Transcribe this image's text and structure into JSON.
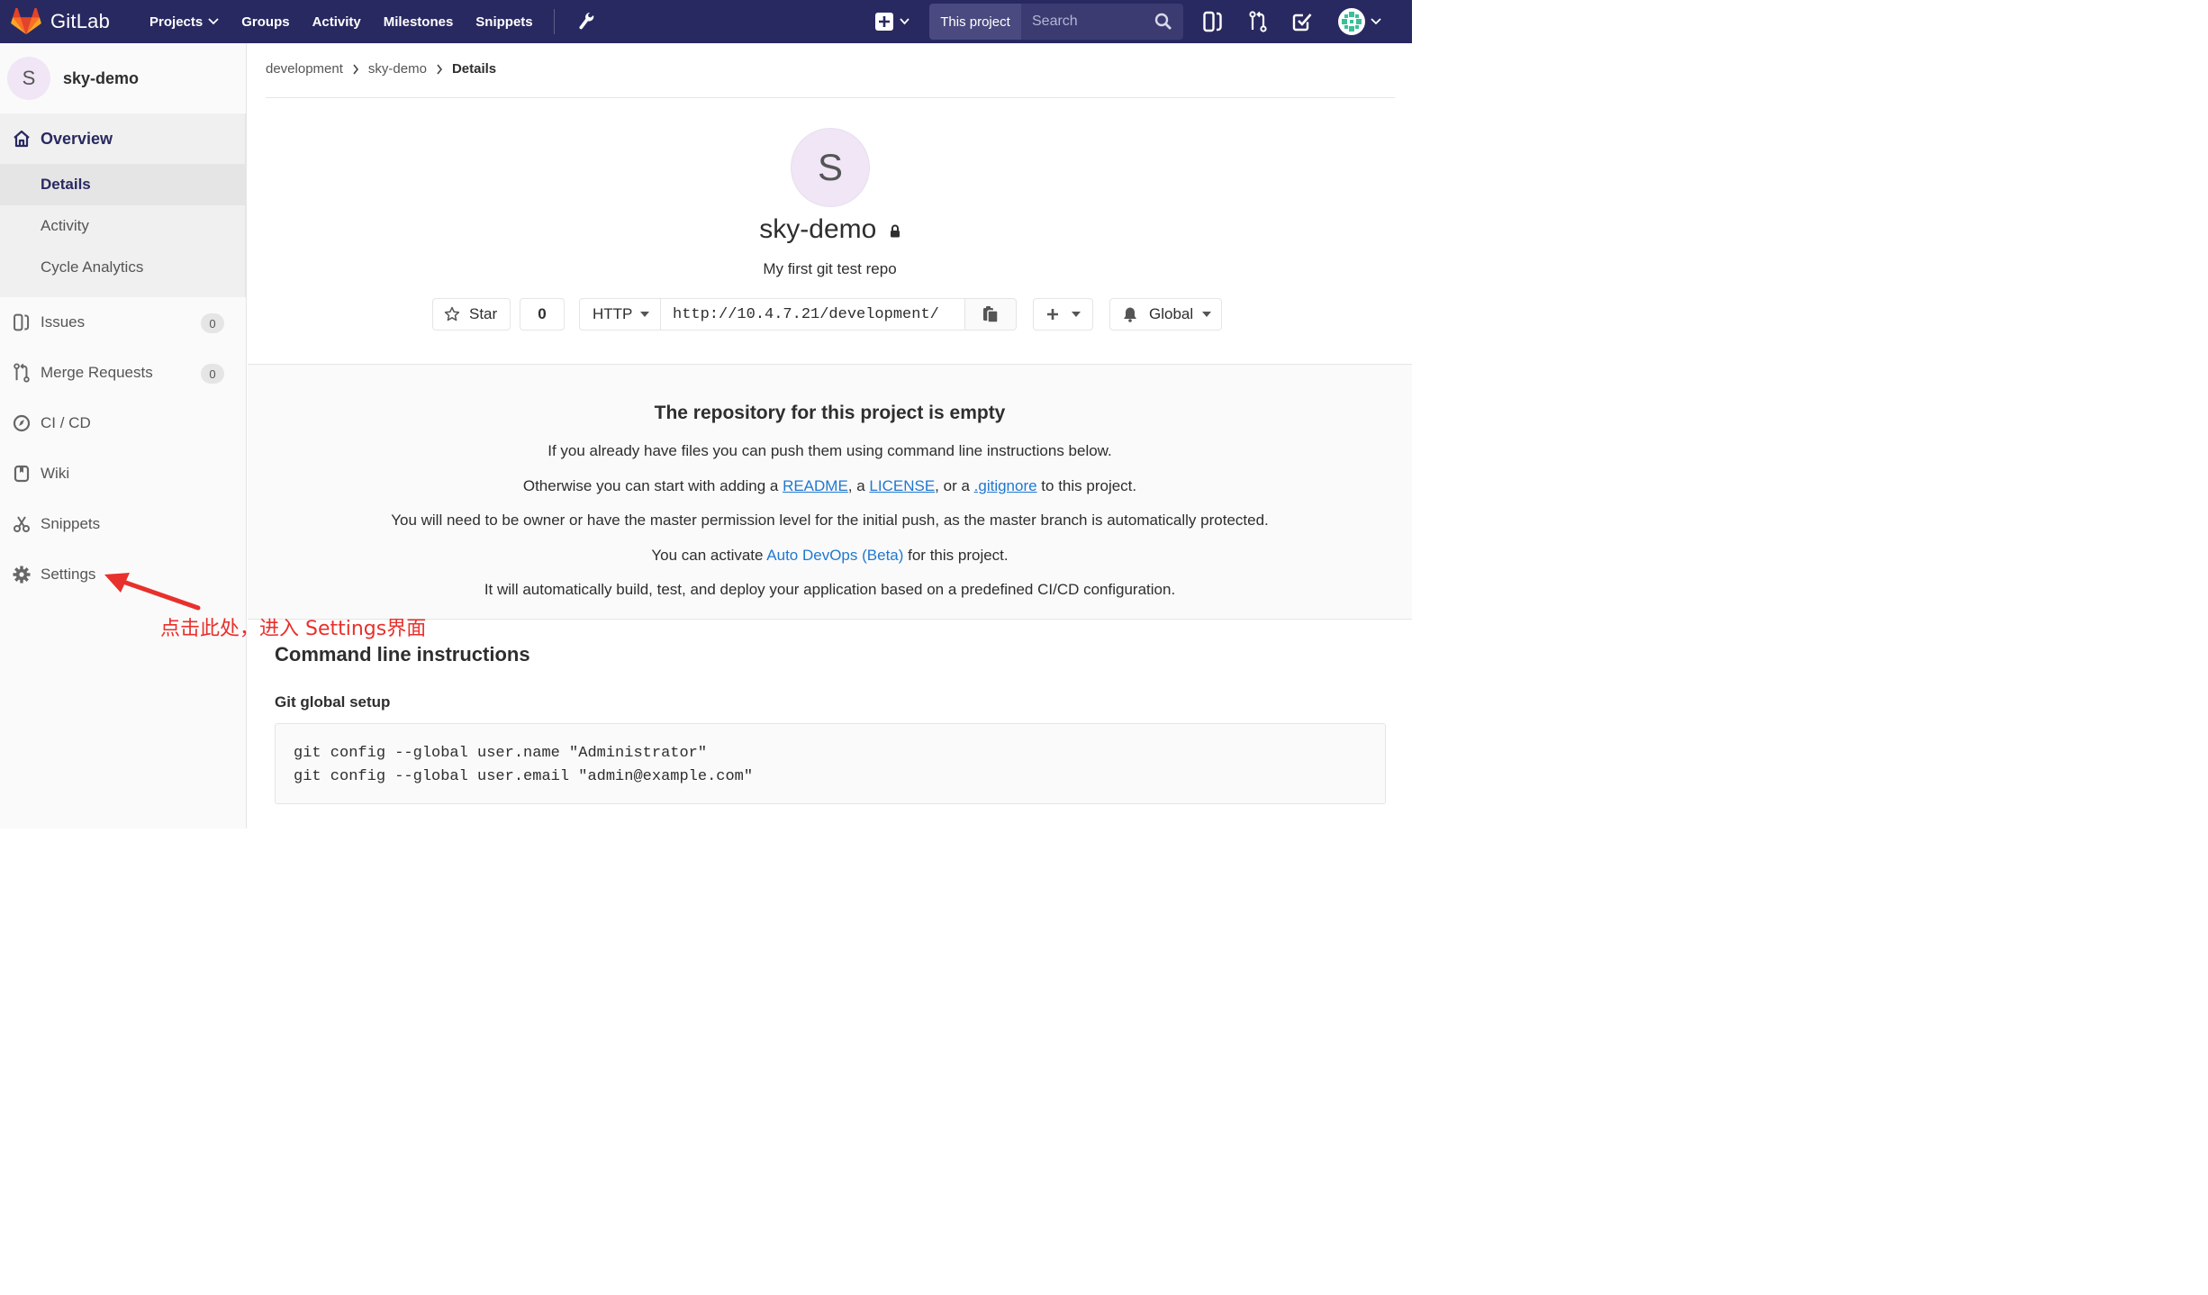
{
  "navbar": {
    "brand": "GitLab",
    "links": [
      {
        "label": "Projects",
        "has_caret": true
      },
      {
        "label": "Groups"
      },
      {
        "label": "Activity"
      },
      {
        "label": "Milestones"
      },
      {
        "label": "Snippets"
      }
    ],
    "search_scope": "This project",
    "search_placeholder": "Search",
    "colors": {
      "bg": "#292961",
      "brand_orange": "#fc6d26"
    }
  },
  "sidebar": {
    "project_initial": "S",
    "project_name": "sky-demo",
    "overview_label": "Overview",
    "overview_sub": [
      {
        "label": "Details",
        "active": true
      },
      {
        "label": "Activity"
      },
      {
        "label": "Cycle Analytics"
      }
    ],
    "items": [
      {
        "label": "Issues",
        "icon": "issues-icon",
        "badge": "0"
      },
      {
        "label": "Merge Requests",
        "icon": "merge-request-icon",
        "badge": "0"
      },
      {
        "label": "CI / CD",
        "icon": "rocket-icon"
      },
      {
        "label": "Wiki",
        "icon": "book-icon"
      },
      {
        "label": "Snippets",
        "icon": "scissors-icon"
      },
      {
        "label": "Settings",
        "icon": "gear-icon"
      }
    ]
  },
  "breadcrumb": [
    "development",
    "sky-demo",
    "Details"
  ],
  "project": {
    "initial": "S",
    "title": "sky-demo",
    "description": "My first git test repo",
    "star_label": "Star",
    "star_count": "0",
    "protocol": "HTTP",
    "clone_url": "http://10.4.7.21/development/",
    "notification": "Global"
  },
  "empty_repo": {
    "title": "The repository for this project is empty",
    "line1": "If you already have files you can push them using command line instructions below.",
    "line2_prefix": "Otherwise you can start with adding a ",
    "readme": "README",
    "sep1": ", a ",
    "license": "LICENSE",
    "sep2": ", or a ",
    "gitignore": ".gitignore",
    "line2_suffix": " to this project.",
    "line3": "You will need to be owner or have the master permission level for the initial push, as the master branch is automatically protected.",
    "line4_prefix": "You can activate ",
    "autodevops": "Auto DevOps (Beta)",
    "line4_suffix": " for this project.",
    "line5": "It will automatically build, test, and deploy your application based on a predefined CI/CD configuration."
  },
  "cli": {
    "title": "Command line instructions",
    "git_setup_title": "Git global setup",
    "code": [
      "git config --global user.name \"Administrator\"",
      "git config --global user.email \"admin@example.com\""
    ]
  },
  "annotation": {
    "text": "点击此处，进入 Settings界面",
    "color": "#e8302c"
  }
}
